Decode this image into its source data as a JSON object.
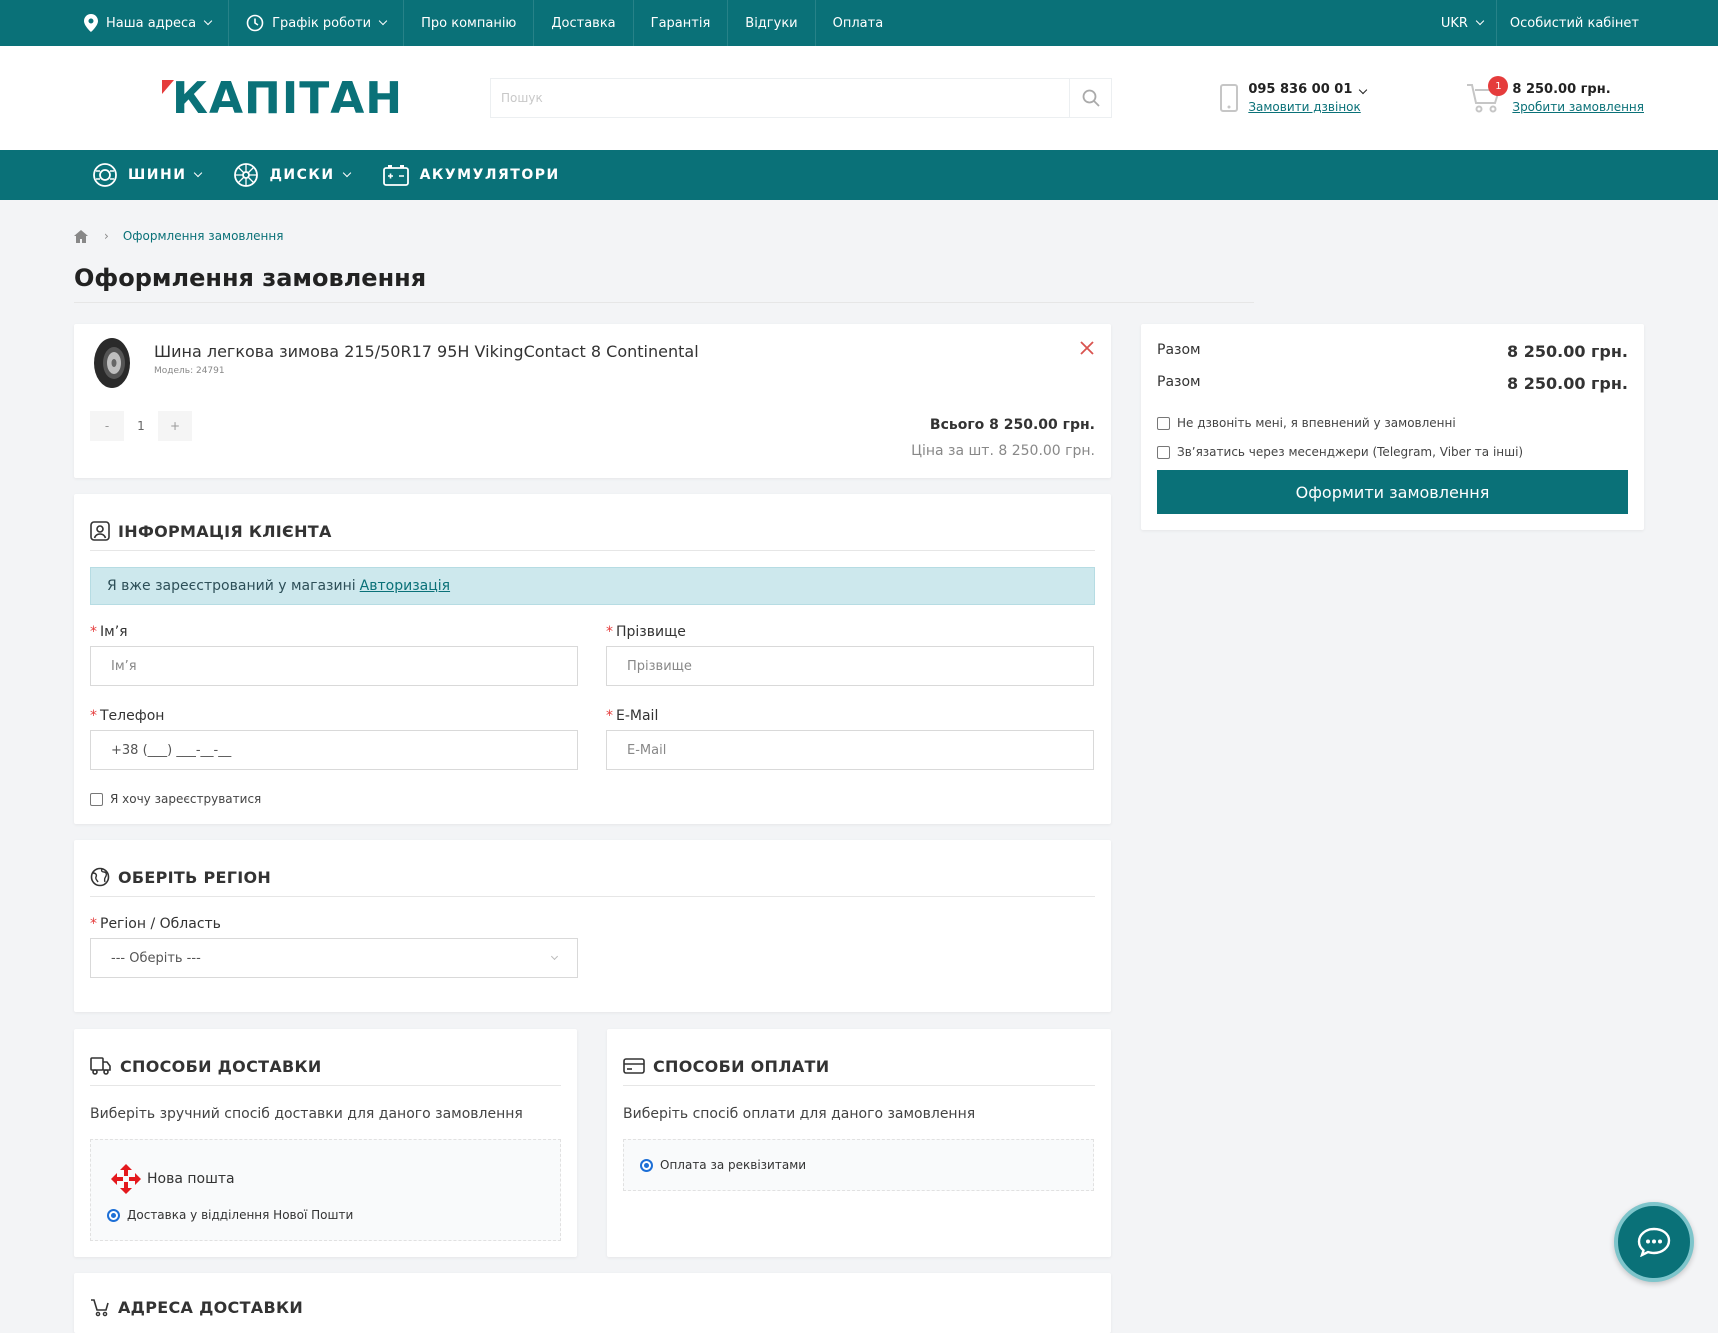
{
  "topbar": {
    "address": "Наша адреса",
    "schedule": "Графік роботи",
    "links": [
      "Про компанію",
      "Доставка",
      "Гарантія",
      "Відгуки",
      "Оплата"
    ],
    "lang": "UKR",
    "account": "Особистий кабінет"
  },
  "header": {
    "logo": "КАПІТАН",
    "search_placeholder": "Пошук",
    "phone": "095 836 00 01",
    "callback": "Замовити дзвінок",
    "cart_count": "1",
    "cart_total": "8 250.00 грн.",
    "cart_link": "Зробити замовлення"
  },
  "categories": [
    "ШИНИ",
    "ДИСКИ",
    "АКУМУЛЯТОРИ"
  ],
  "breadcrumb": {
    "current": "Оформлення замовлення"
  },
  "page_title": "Оформлення замовлення",
  "product": {
    "name": "Шина легкова зимова 215/50R17 95H VikingContact 8 Continental",
    "model": "Модель: 24791",
    "minus": "-",
    "qty": "1",
    "plus": "+",
    "total": "Всього 8 250.00 грн.",
    "unit_price": "Ціна за шт. 8 250.00 грн."
  },
  "customer": {
    "title": "ІНФОРМАЦІЯ КЛІЄНТА",
    "alert_text": "Я вже зареєстрований у магазині",
    "alert_link": "Авторизація",
    "first_name_label": "Ім’я",
    "first_name_placeholder": "Ім’я",
    "last_name_label": "Прізвище",
    "last_name_placeholder": "Прізвище",
    "phone_label": "Телефон",
    "phone_value": "+38 (___) ___-__-__",
    "email_label": "E-Mail",
    "email_placeholder": "E-Mail",
    "register": "Я хочу зареєструватися"
  },
  "region": {
    "title": "ОБЕРІТЬ РЕГІОН",
    "label": "Регіон / Область",
    "selected": "--- Оберіть ---"
  },
  "delivery": {
    "title": "СПОСОБИ ДОСТАВКИ",
    "hint": "Виберіть зручний спосіб доставки для даного замовлення",
    "carrier": "Нова пошта",
    "option": "Доставка у відділення Нової Пошти"
  },
  "payment": {
    "title": "СПОСОБИ ОПЛАТИ",
    "hint": "Виберіть спосіб оплати для даного замовлення",
    "option": "Оплата за реквізитами"
  },
  "address": {
    "title": "АДРЕСА ДОСТАВКИ"
  },
  "summary": {
    "row1_label": "Разом",
    "row1_value": "8 250.00 грн.",
    "row2_label": "Разом",
    "row2_value": "8 250.00 грн.",
    "no_call": "Не дзвоніть мені, я впевнений у замовленні",
    "messenger": "Зв’язатись через месенджери (Telegram, Viber та інші)",
    "order_button": "Оформити замовлення"
  },
  "colors": {
    "brand": "#0a7178",
    "accent": "#e53c3c",
    "radio": "#1d6fd6"
  }
}
